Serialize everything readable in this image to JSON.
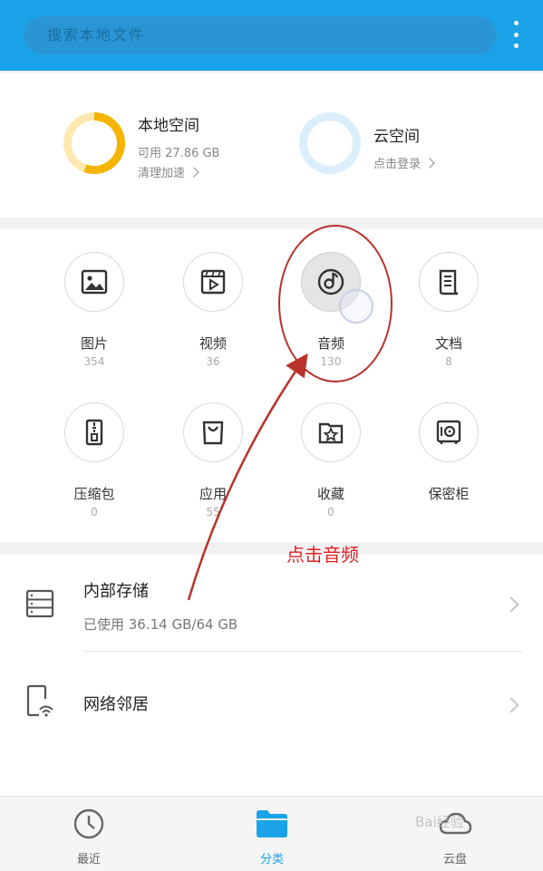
{
  "search": {
    "placeholder": "搜索本地文件"
  },
  "storage": {
    "local": {
      "title": "本地空间",
      "available": "可用 27.86 GB",
      "action": "清理加速"
    },
    "cloud": {
      "title": "云空间",
      "action": "点击登录"
    }
  },
  "categories": [
    {
      "label": "图片",
      "count": "354",
      "icon": "image-icon"
    },
    {
      "label": "视频",
      "count": "36",
      "icon": "video-icon"
    },
    {
      "label": "音频",
      "count": "130",
      "icon": "music-icon"
    },
    {
      "label": "文档",
      "count": "8",
      "icon": "document-icon"
    },
    {
      "label": "压缩包",
      "count": "0",
      "icon": "archive-icon"
    },
    {
      "label": "应用",
      "count": "55",
      "icon": "shopping-bag-icon"
    },
    {
      "label": "收藏",
      "count": "0",
      "icon": "star-folder-icon"
    },
    {
      "label": "保密柜",
      "count": "",
      "icon": "safe-icon"
    }
  ],
  "list": {
    "internal": {
      "title": "内部存储",
      "usage": "已使用 36.14 GB/64 GB"
    },
    "network": {
      "title": "网络邻居"
    }
  },
  "nav": {
    "recent": "最近",
    "category": "分类",
    "cloud": "云盘"
  },
  "annotation": {
    "text": "点击音频"
  },
  "watermark": "Bai经验",
  "colors": {
    "topbar": "#1aa3e8",
    "accent": "#1aa3e8",
    "local_ring": "#f5b400",
    "annotation": "#e02020"
  }
}
